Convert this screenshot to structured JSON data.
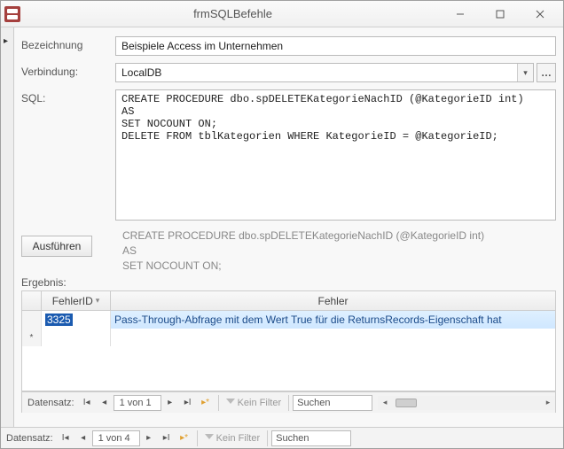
{
  "window": {
    "title": "frmSQLBefehle"
  },
  "form": {
    "bezeichnung_label": "Bezeichnung",
    "bezeichnung_value": "Beispiele Access im Unternehmen",
    "verbindung_label": "Verbindung:",
    "verbindung_value": "LocalDB",
    "sql_label": "SQL:",
    "sql_value": "CREATE PROCEDURE dbo.spDELETEKategorieNachID (@KategorieID int)\nAS\nSET NOCOUNT ON;\nDELETE FROM tblKategorien WHERE KategorieID = @KategorieID;",
    "execute_label": "Ausführen",
    "echo_text": "CREATE PROCEDURE dbo.spDELETEKategorieNachID (@KategorieID int)\nAS\nSET NOCOUNT ON;",
    "ergebnis_label": "Ergebnis:"
  },
  "grid": {
    "col_id": "FehlerID",
    "col_err": "Fehler",
    "rows": [
      {
        "id": "3325",
        "text": "Pass-Through-Abfrage mit dem Wert True für die ReturnsRecords-Eigenschaft hat"
      }
    ]
  },
  "nav_inner": {
    "label": "Datensatz:",
    "counter": "1 von 1",
    "filter": "Kein Filter",
    "search_placeholder": "Suchen"
  },
  "nav_outer": {
    "label": "Datensatz:",
    "counter": "1 von 4",
    "filter": "Kein Filter",
    "search_placeholder": "Suchen"
  }
}
